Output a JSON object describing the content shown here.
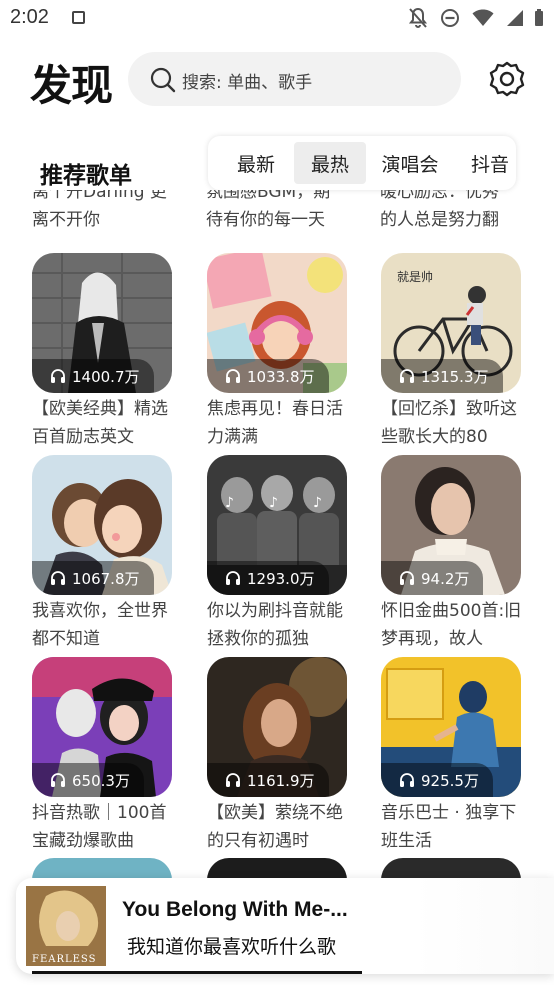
{
  "status": {
    "time": "2:02"
  },
  "header": {
    "logo": "发现",
    "search_placeholder": "搜索: 单曲、歌手"
  },
  "section": {
    "title": "推荐歌单",
    "tabs": [
      {
        "label": "最新",
        "active": false
      },
      {
        "label": "最热",
        "active": true
      },
      {
        "label": "演唱会",
        "active": false
      },
      {
        "label": "抖音",
        "active": false
      }
    ]
  },
  "partial_titles": [
    "离个开Darling 更\n离不开你",
    "氛围感BGM，期\n待有你的每一天",
    "暖心励志：优秀\n的人总是努力翻"
  ],
  "playlists": [
    {
      "title": "【欧美经典】精选百首励志英文",
      "plays": "1400.7万"
    },
    {
      "title": "焦虑再见！春日活力满满",
      "plays": "1033.8万"
    },
    {
      "title": "【回忆杀】致听这些歌长大的80",
      "plays": "1315.3万"
    },
    {
      "title": "我喜欢你，全世界都不知道",
      "plays": "1067.8万"
    },
    {
      "title": "你以为刷抖音就能拯救你的孤独",
      "plays": "1293.0万"
    },
    {
      "title": "怀旧金曲500首:旧梦再现，故人",
      "plays": "94.2万"
    },
    {
      "title": "抖音热歌｜100首宝藏劲爆歌曲",
      "plays": "650.3万"
    },
    {
      "title": "【欧美】萦绕不绝的只有初遇时",
      "plays": "1161.9万"
    },
    {
      "title": "音乐巴士 · 独享下班生活",
      "plays": "925.5万"
    }
  ],
  "cover_text": {
    "bike_caption": "就是帅",
    "album_text": "FEARLESS"
  },
  "player": {
    "song": "You Belong With Me-...",
    "lyric": "我知道你最喜欢听什么歌"
  }
}
